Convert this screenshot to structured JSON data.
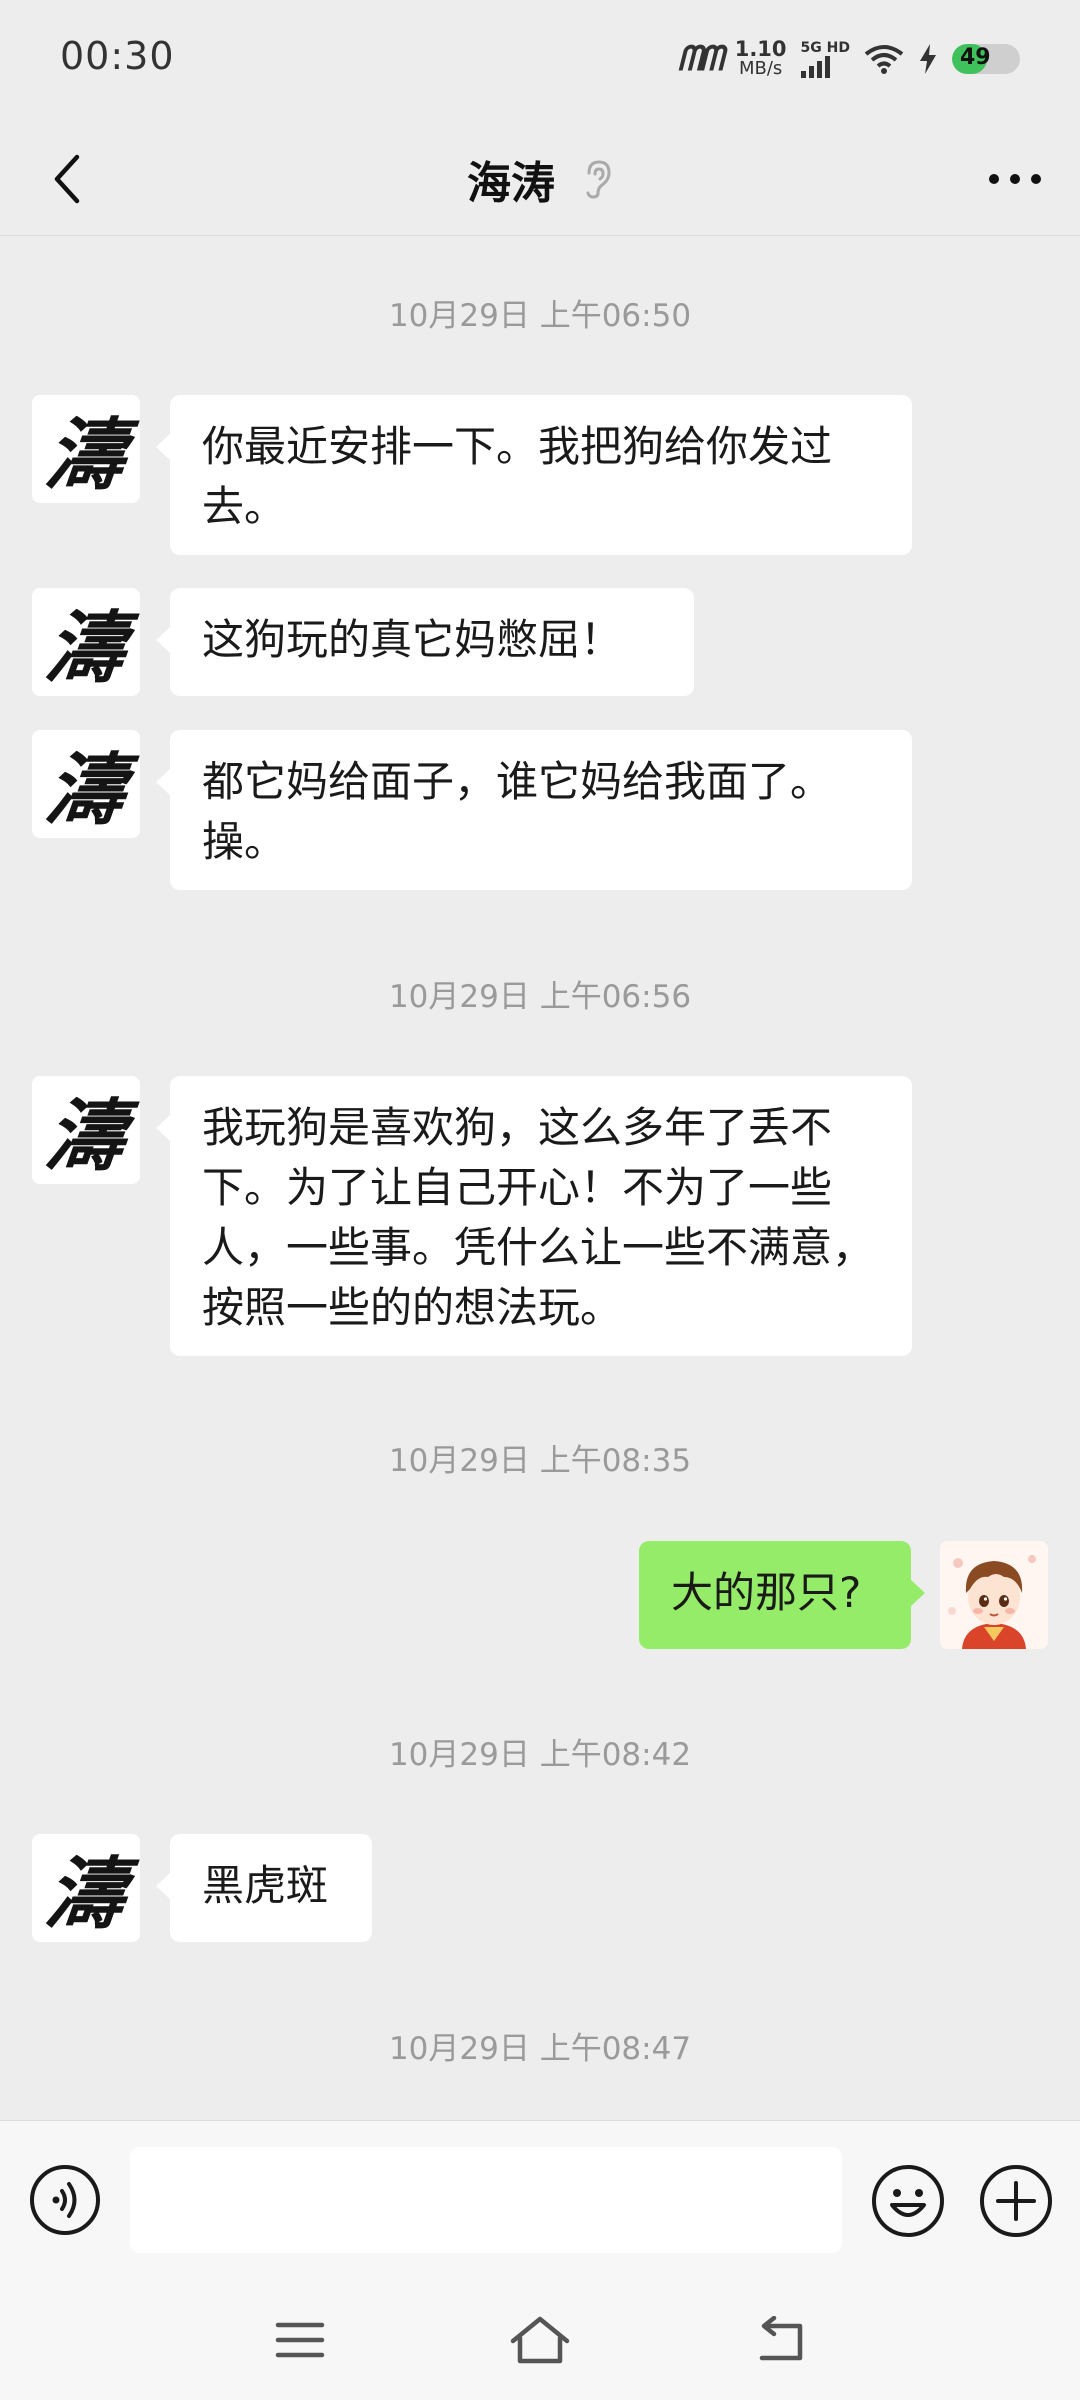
{
  "status_bar": {
    "time": "00:30",
    "carrier": "ᗰᗰ",
    "net_speed_value": "1.10",
    "net_speed_unit": "MB/s",
    "network_type": "5G HD",
    "battery_level": "49",
    "colors": {
      "battery_fill": "#3fc25b"
    }
  },
  "header": {
    "title": "海涛",
    "icons": {
      "back": "back-arrow-icon",
      "mode": "earpiece-icon",
      "more": "more-dots-icon"
    }
  },
  "chat": {
    "contact_avatar_char": "濤",
    "timestamps": [
      "10月29日 上午06:50",
      "10月29日 上午06:56",
      "10月29日 上午08:35",
      "10月29日 上午08:42",
      "10月29日 上午08:47"
    ],
    "messages": [
      {
        "from": "contact",
        "text": "你最近安排一下。我把狗给你发过去。"
      },
      {
        "from": "contact",
        "text": "这狗玩的真它妈憋屈！"
      },
      {
        "from": "contact",
        "text": "都它妈给面子，谁它妈给我面了。操。"
      },
      {
        "from": "contact",
        "text": "我玩狗是喜欢狗，这么多年了丢不下。为了让自己开心！不为了一些人，一些事。凭什么让一些不满意，按照一些的的想法玩。"
      },
      {
        "from": "me",
        "text": "大的那只?"
      },
      {
        "from": "contact",
        "text": "黑虎斑"
      }
    ],
    "colors": {
      "incoming_bubble": "#ffffff",
      "outgoing_bubble": "#95ec69",
      "background": "#ededed"
    }
  },
  "input_bar": {
    "value": "",
    "icons": {
      "voice": "voice-input-icon",
      "emoji": "emoji-icon",
      "plus": "plus-icon"
    }
  },
  "nav_bar": {
    "icons": [
      "menu-icon",
      "home-icon",
      "back-icon"
    ]
  }
}
